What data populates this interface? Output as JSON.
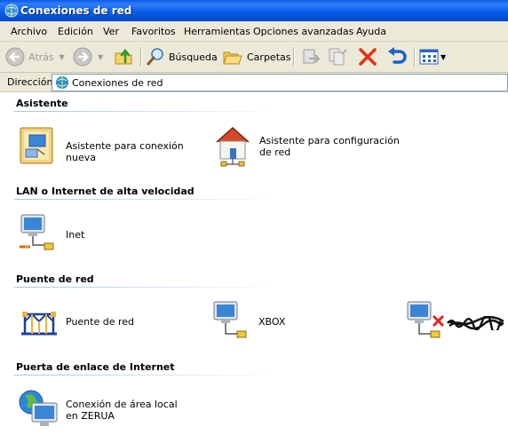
{
  "window": {
    "title": "Conexiones de red"
  },
  "menu": [
    "Archivo",
    "Edición",
    "Ver",
    "Favoritos",
    "Herramientas",
    "Opciones avanzadas",
    "Ayuda"
  ],
  "toolbar": {
    "back_label": "Atrás",
    "search_label": "Búsqueda",
    "folders_label": "Carpetas"
  },
  "address": {
    "label": "Dirección",
    "value": "Conexiones de red"
  },
  "groups": [
    {
      "title": "Asistente",
      "items": [
        {
          "label": "Asistente para conexión nueva",
          "icon": "wizard-icon"
        },
        {
          "label": "Asistente para configuración de red",
          "icon": "home-network-icon"
        }
      ]
    },
    {
      "title": "LAN o Internet de alta velocidad",
      "items": [
        {
          "label": "Inet",
          "icon": "lan-connection-icon"
        }
      ]
    },
    {
      "title": "Puente de red",
      "items": [
        {
          "label": "Puente de red",
          "icon": "network-bridge-icon"
        },
        {
          "label": "XBOX",
          "icon": "lan-connection-icon"
        },
        {
          "label": "",
          "icon": "lan-disconnected-icon"
        }
      ]
    },
    {
      "title": "Puerta de enlace de Internet",
      "items": [
        {
          "label": "Conexión de área local en ZERUA",
          "icon": "internet-gateway-icon"
        }
      ]
    }
  ],
  "colors": {
    "titlebar": "#0a5ae6",
    "chrome": "#ece9d8",
    "group_line": "#a6c2e5"
  }
}
